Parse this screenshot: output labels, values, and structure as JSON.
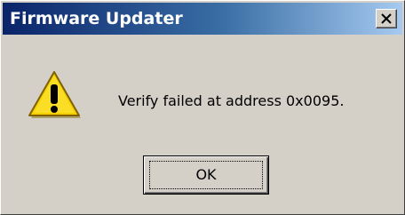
{
  "window": {
    "title": "Firmware Updater",
    "close_icon": "close-icon"
  },
  "dialog": {
    "icon": "warning-icon",
    "message": "Verify failed at address 0x0095.",
    "ok_label": "OK"
  },
  "colors": {
    "titlebar_start": "#0a246a",
    "titlebar_end": "#a6caf0",
    "face": "#d4d0c8",
    "warning_yellow": "#f5d000"
  }
}
